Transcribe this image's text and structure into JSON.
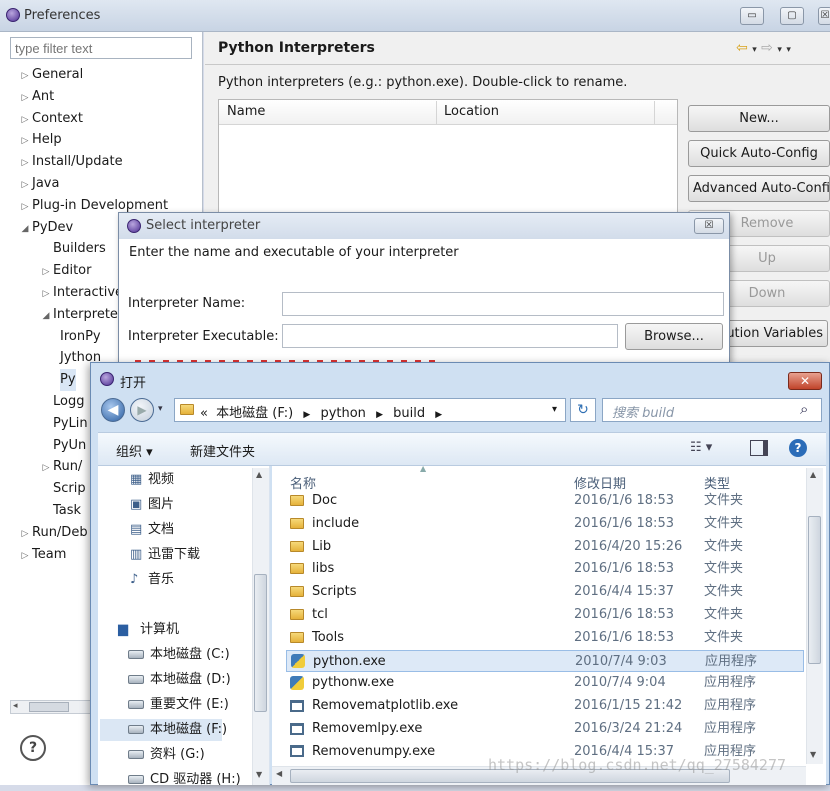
{
  "window": {
    "title": "Preferences",
    "min": "▭",
    "max": "▢",
    "close": "☒"
  },
  "filter": {
    "placeholder": "type filter text"
  },
  "tree": {
    "top_items": [
      "General",
      "Ant",
      "Context",
      "Help",
      "Install/Update",
      "Java",
      "Plug-in Development",
      "PyDev"
    ],
    "pydev_children": [
      "Builders",
      "Editor",
      "Interactive",
      "Interprete"
    ],
    "interpreter_children": [
      "IronPy",
      "Jython",
      "Py"
    ],
    "more_pydev": [
      "Logg",
      "PyLin",
      "PyUn",
      "Run/",
      "Scrip",
      "Task"
    ],
    "bottom_items": [
      "Run/Deb",
      "Team"
    ]
  },
  "help_icon": "?",
  "page": {
    "title": "Python Interpreters",
    "description": "Python interpreters (e.g.: python.exe).   Double-click to rename.",
    "columns": [
      "Name",
      "Location"
    ],
    "buttons": {
      "new": "New...",
      "quick": "Quick Auto-Config",
      "advanced": "Advanced Auto-Config",
      "remove": "Remove",
      "up": "Up",
      "down": "Down",
      "env": "ution Variables"
    }
  },
  "select_dialog": {
    "title": "Select interpreter",
    "close": "☒",
    "instruction": "Enter the name and executable of your interpreter",
    "name_label": "Interpreter Name:",
    "exe_label": "Interpreter Executable:",
    "browse": "Browse..."
  },
  "open_dialog": {
    "title": "打开",
    "close": "✕",
    "breadcrumb": [
      "«",
      "本地磁盘 (F:)",
      "python",
      "build"
    ],
    "search_placeholder": "搜索 build",
    "toolbar": {
      "organize": "组织 ▾",
      "new_folder": "新建文件夹"
    },
    "nav": {
      "libraries": [
        "视频",
        "图片",
        "文档",
        "迅雷下载",
        "音乐"
      ],
      "computer": "计算机",
      "drives": [
        "本地磁盘 (C:)",
        "本地磁盘 (D:)",
        "重要文件 (E:)",
        "本地磁盘 (F:)",
        "资料 (G:)",
        "CD 驱动器 (H:)"
      ]
    },
    "columns": [
      "名称",
      "修改日期",
      "类型"
    ],
    "files": [
      {
        "name": "Doc",
        "date": "2016/1/6 18:53",
        "type": "文件夹",
        "icon": "folder"
      },
      {
        "name": "include",
        "date": "2016/1/6 18:53",
        "type": "文件夹",
        "icon": "folder"
      },
      {
        "name": "Lib",
        "date": "2016/4/20 15:26",
        "type": "文件夹",
        "icon": "folder"
      },
      {
        "name": "libs",
        "date": "2016/1/6 18:53",
        "type": "文件夹",
        "icon": "folder"
      },
      {
        "name": "Scripts",
        "date": "2016/4/4 15:37",
        "type": "文件夹",
        "icon": "folder"
      },
      {
        "name": "tcl",
        "date": "2016/1/6 18:53",
        "type": "文件夹",
        "icon": "folder"
      },
      {
        "name": "Tools",
        "date": "2016/1/6 18:53",
        "type": "文件夹",
        "icon": "folder"
      },
      {
        "name": "python.exe",
        "date": "2010/7/4 9:03",
        "type": "应用程序",
        "icon": "python"
      },
      {
        "name": "pythonw.exe",
        "date": "2010/7/4 9:04",
        "type": "应用程序",
        "icon": "python"
      },
      {
        "name": "Removematplotlib.exe",
        "date": "2016/1/15 21:42",
        "type": "应用程序",
        "icon": "exe"
      },
      {
        "name": "Removemlpy.exe",
        "date": "2016/3/24 21:24",
        "type": "应用程序",
        "icon": "exe"
      },
      {
        "name": "Removenumpy.exe",
        "date": "2016/4/4 15:37",
        "type": "应用程序",
        "icon": "exe"
      }
    ]
  },
  "watermark": "https://blog.csdn.net/qq_27584277"
}
